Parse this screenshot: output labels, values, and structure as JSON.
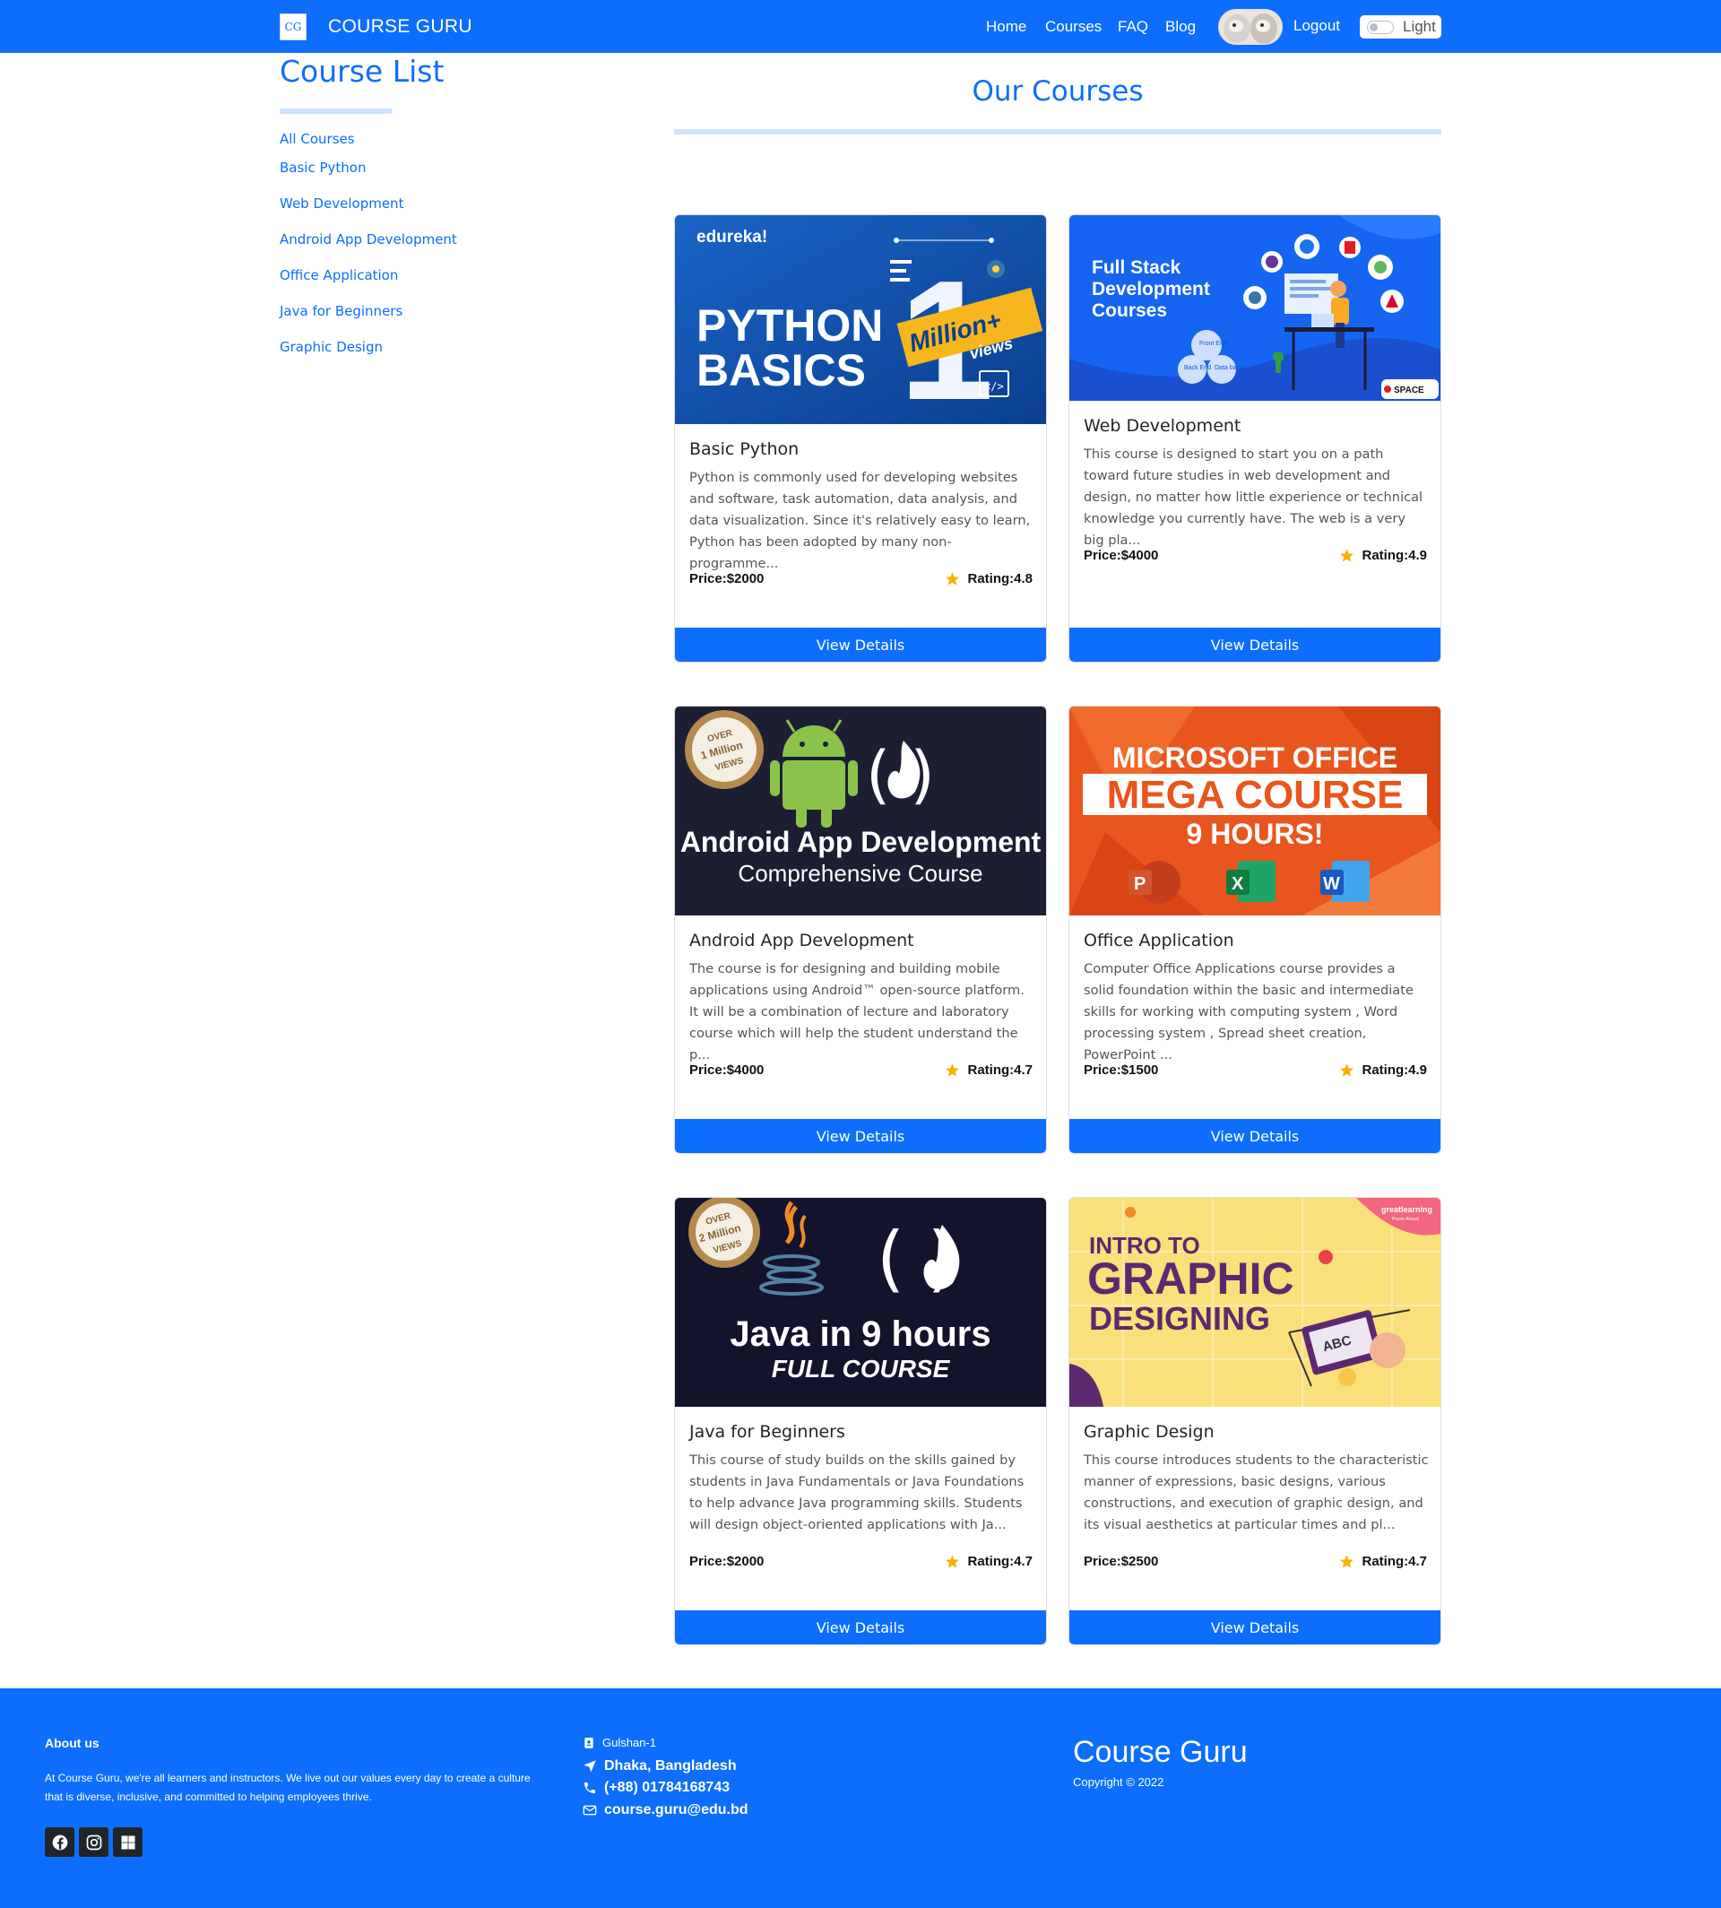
{
  "colors": {
    "primary": "#0d6efd",
    "light_blue": "#cfe2ff",
    "star": "#f5b301",
    "dark": "#212529"
  },
  "navbar": {
    "logo_text": "CG",
    "brand": "COURSE GURU",
    "links": [
      "Home",
      "Courses",
      "FAQ",
      "Blog"
    ],
    "logout": "Logout",
    "theme_toggle_label": "Light"
  },
  "sidebar": {
    "title": "Course List",
    "items": [
      "All Courses",
      "Basic Python",
      "Web Development",
      "Android App Development",
      "Office Application",
      "Java for Beginners",
      "Graphic Design"
    ]
  },
  "main": {
    "title": "Our Courses",
    "courses": [
      {
        "title": "Basic Python",
        "description": "Python is commonly used for developing websites and software, task automation, data analysis, and data visualization. Since it's relatively easy to learn, Python has been adopted by many non-programme...",
        "price": "Price:$2000",
        "rating": "Rating:4.8",
        "button": "View Details",
        "image": {
          "brand": "edureka!",
          "line1": "PYTHON",
          "line2": "BASICS",
          "badge": "Million+",
          "badge_sub": "views",
          "badge_num": "1"
        }
      },
      {
        "title": "Web Development",
        "description": "This course is designed to start you on a path toward future studies in web development and design, no matter how little experience or technical knowledge you currently have. The web is a very big pla...",
        "price": "Price:$4000",
        "rating": "Rating:4.9",
        "button": "View Details",
        "image": {
          "line1": "Full Stack",
          "line2": "Development",
          "line3": "Courses",
          "front": "Front End",
          "back": "Back End",
          "data": "Data base",
          "logo": "SPACE"
        }
      },
      {
        "title": "Android App Development",
        "description": "The course is for designing and building mobile applications using Android™ open-source platform. It will be a combination of lecture and laboratory course which will help the student understand the p...",
        "price": "Price:$4000",
        "rating": "Rating:4.7",
        "button": "View Details",
        "image": {
          "line1": "Android App Development",
          "line2": "Comprehensive Course",
          "seal_top": "OVER",
          "seal_mid": "1 Million",
          "seal_bot": "VIEWS"
        }
      },
      {
        "title": "Office Application",
        "description": "Computer Office Applications course provides a solid foundation within the basic and intermediate skills for working with computing system , Word processing system , Spread sheet creation, PowerPoint ...",
        "price": "Price:$1500",
        "rating": "Rating:4.9",
        "button": "View Details",
        "image": {
          "line1": "MICROSOFT OFFICE",
          "line2": "MEGA COURSE",
          "line3": "9 HOURS!",
          "p": "P",
          "x": "X",
          "w": "W"
        }
      },
      {
        "title": "Java for Beginners",
        "description": "This course of study builds on the skills gained by students in Java Fundamentals or Java Foundations to help advance Java programming skills. Students will design object-oriented applications with Ja...",
        "price": "Price:$2000",
        "rating": "Rating:4.7",
        "button": "View Details",
        "image": {
          "line1": "Java in 9 hours",
          "line2": "FULL COURSE",
          "seal_top": "OVER",
          "seal_mid": "2 Million",
          "seal_bot": "VIEWS"
        }
      },
      {
        "title": "Graphic Design",
        "description": "This course introduces students to the characteristic manner of expressions, basic designs, various constructions, and execution of graphic design, and its visual aesthetics at particular times and pl...",
        "price": "Price:$2500",
        "rating": "Rating:4.7",
        "button": "View Details",
        "image": {
          "line1": "INTRO TO",
          "line2": "GRAPHIC",
          "line3": "DESIGNING",
          "brand": "greatlearning",
          "brand_sub": "Power Ahead",
          "abc": "ABC"
        }
      }
    ]
  },
  "footer": {
    "about_title": "About us",
    "about_text": "At Course Guru, we're all learners and instructors. We live out our values every day to create a culture that is diverse, inclusive, and committed to helping employees thrive.",
    "address1": "Gulshan-1",
    "address2": "Dhaka, Bangladesh",
    "phone": "(+88) 01784168743",
    "email": "course.guru@edu.bd",
    "brand": "Course Guru",
    "copyright": "Copyright © 2022",
    "social_icons": [
      "facebook-icon",
      "instagram-icon",
      "windows-icon"
    ]
  }
}
